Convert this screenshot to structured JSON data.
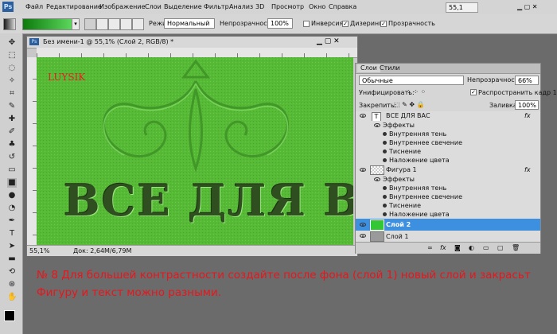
{
  "app": {
    "logo": "Ps"
  },
  "menu": [
    "Файл",
    "Редактирование",
    "Изображение",
    "Слои",
    "Выделение",
    "Фильтр",
    "Анализ",
    "3D",
    "Просмотр",
    "Окно",
    "Справка"
  ],
  "menu_right": {
    "zoom": "55,1"
  },
  "options": {
    "mode_label": "Режим:",
    "mode_value": "Нормальный",
    "opacity_label": "Непрозрачность:",
    "opacity_value": "100%",
    "inversion": "Инверсия",
    "dither": "Дизеринг",
    "transparency": "Прозрачность"
  },
  "document": {
    "tab_title": "Без имени-1 @ 55,1% (Слой 2, RGB/8) *",
    "status_zoom": "55,1%",
    "status_doc": "Док: 2,64M/6,79M",
    "canvas_signature": "LUYSIK",
    "canvas_text": "ВСЕ ДЛЯ ВАС",
    "canvas_color": "#55b735"
  },
  "layers_panel": {
    "tabs": [
      "Слои",
      "Стили"
    ],
    "blend_mode": "Обычные",
    "opacity_label": "Непрозрачность:",
    "opacity_value": "66%",
    "unify_label": "Унифицировать:",
    "propagate_label": "Распространить кадр 1",
    "lock_label": "Закрепить:",
    "fill_label": "Заливка:",
    "fill_value": "100%",
    "layers": [
      {
        "name": "ВСЕ ДЛЯ ВАС",
        "kind": "text",
        "effects_label": "Эффекты",
        "effects": [
          "Внутренняя тень",
          "Внутреннее свечение",
          "Тиснение",
          "Наложение цвета"
        ]
      },
      {
        "name": "Фигура 1",
        "kind": "shape",
        "effects_label": "Эффекты",
        "effects": [
          "Внутренняя тень",
          "Внутреннее свечение",
          "Тиснение",
          "Наложение цвета"
        ]
      },
      {
        "name": "Слой 2",
        "kind": "fill",
        "selected": true
      },
      {
        "name": "Слой 1",
        "kind": "plain"
      }
    ],
    "fx": "fx",
    "text_thumb": "T"
  },
  "instructions": {
    "line1": "№ 8 Для большей контрастности создайте после фона (слой 1) новый слой и закрасьт",
    "line2": "Фигуру и текст можно разными."
  }
}
